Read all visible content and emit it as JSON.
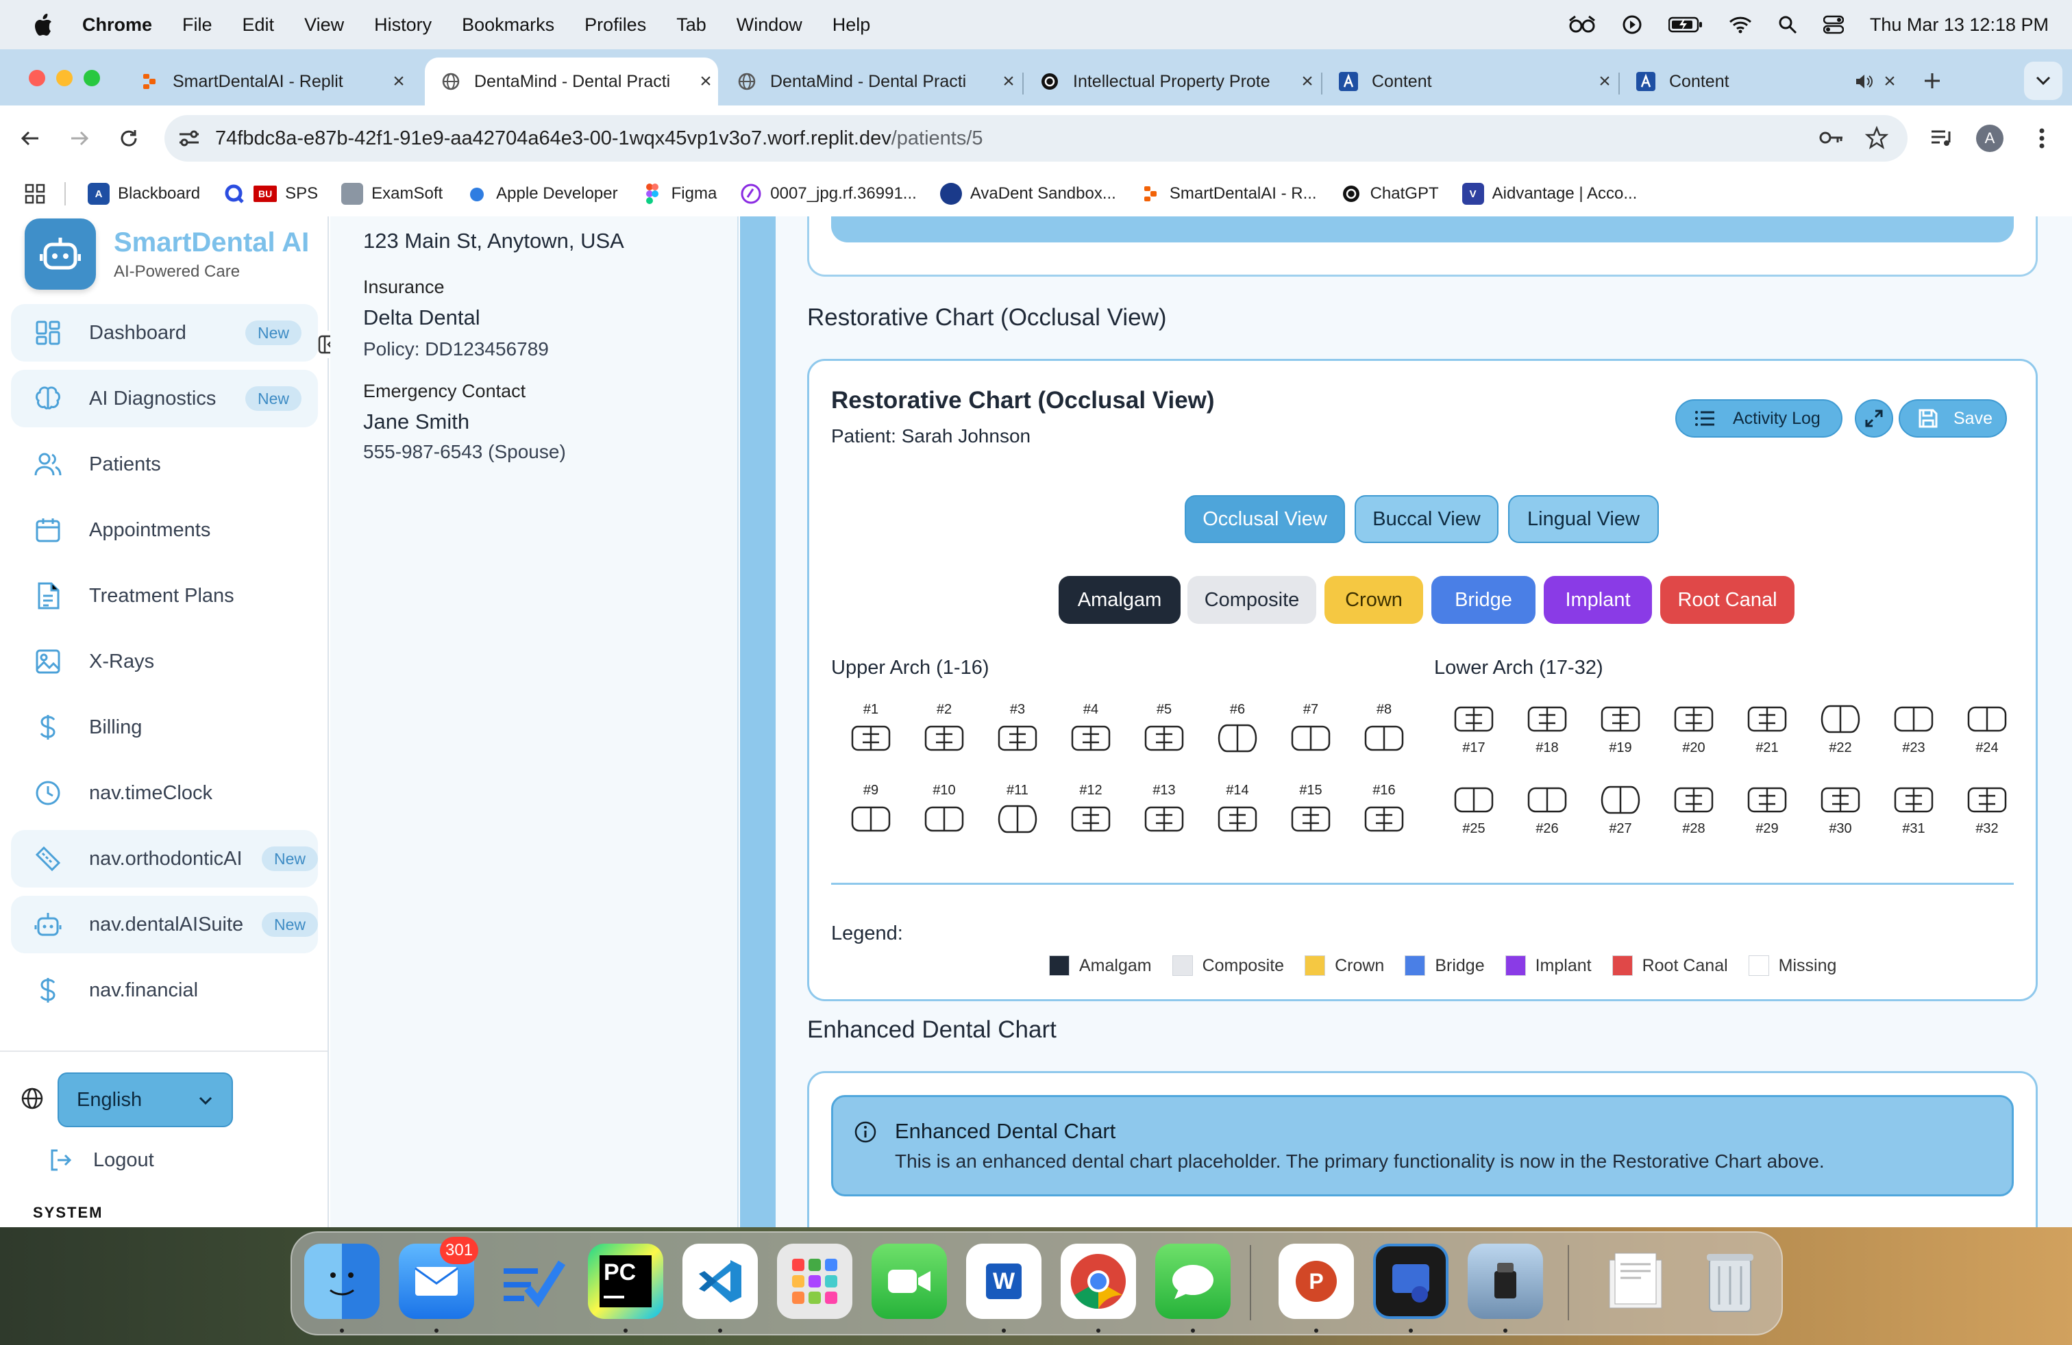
{
  "menubar": {
    "app": "Chrome",
    "items": [
      "File",
      "Edit",
      "View",
      "History",
      "Bookmarks",
      "Profiles",
      "Tab",
      "Window",
      "Help"
    ],
    "clock": "Thu Mar 13  12:18 PM"
  },
  "tabs": [
    {
      "title": "SmartDentalAI - Replit",
      "icon": "replit-icon"
    },
    {
      "title": "DentaMind - Dental Practi",
      "icon": "globe-icon"
    },
    {
      "title": "DentaMind - Dental Practi",
      "icon": "globe-icon"
    },
    {
      "title": "Intellectual Property Prote",
      "icon": "openai-icon"
    },
    {
      "title": "Content",
      "icon": "content-icon"
    },
    {
      "title": "Content",
      "icon": "content-icon"
    }
  ],
  "address": {
    "url_host": "74fbdc8a-e87b-42f1-91e9-aa42704a64e3-00-1wqx45vp1v3o7.worf.replit.dev",
    "url_path": "/patients/5"
  },
  "bookmarks": [
    "Blackboard",
    "SPS",
    "ExamSoft",
    "Apple Developer",
    "Figma",
    "0007_jpg.rf.36991...",
    "AvaDent Sandbox...",
    "SmartDentalAI - R...",
    "ChatGPT",
    "Aidvantage | Acco..."
  ],
  "sidebar": {
    "brand_name": "SmartDental AI",
    "brand_tagline": "AI-Powered Care",
    "items": [
      {
        "label": "Dashboard",
        "badge": "New"
      },
      {
        "label": "AI Diagnostics",
        "badge": "New"
      },
      {
        "label": "Patients"
      },
      {
        "label": "Appointments"
      },
      {
        "label": "Treatment Plans"
      },
      {
        "label": "X-Rays"
      },
      {
        "label": "Billing"
      },
      {
        "label": "nav.timeClock"
      },
      {
        "label": "nav.orthodonticAI",
        "badge": "New"
      },
      {
        "label": "nav.dentalAISuite",
        "badge": "New"
      },
      {
        "label": "nav.financial"
      }
    ],
    "language": "English",
    "logout": "Logout",
    "section": "SYSTEM"
  },
  "patient_info": {
    "address": "123 Main St, Anytown, USA",
    "insurance_label": "Insurance",
    "insurance": "Delta Dental",
    "policy": "Policy: DD123456789",
    "emergency_label": "Emergency Contact",
    "emergency_name": "Jane Smith",
    "emergency_phone": "555-987-6543 (Spouse)"
  },
  "restorative": {
    "section_title": "Restorative Chart (Occlusal View)",
    "card_title": "Restorative Chart (Occlusal View)",
    "patient": "Patient: Sarah Johnson",
    "activity_log": "Activity Log",
    "save": "Save",
    "views": [
      "Occlusal View",
      "Buccal View",
      "Lingual View"
    ],
    "materials": [
      {
        "label": "Amalgam",
        "bg": "#1f2937",
        "fg": "#ffffff"
      },
      {
        "label": "Composite",
        "bg": "#e5e7eb",
        "fg": "#1f2937"
      },
      {
        "label": "Crown",
        "bg": "#f5c842",
        "fg": "#3b2f00"
      },
      {
        "label": "Bridge",
        "bg": "#4a7fe6",
        "fg": "#ffffff"
      },
      {
        "label": "Implant",
        "bg": "#8a3be6",
        "fg": "#ffffff"
      },
      {
        "label": "Root Canal",
        "bg": "#e04848",
        "fg": "#ffffff"
      }
    ],
    "upper_title": "Upper Arch (1-16)",
    "lower_title": "Lower Arch (17-32)",
    "upper_row1": [
      "#1",
      "#2",
      "#3",
      "#4",
      "#5",
      "#6",
      "#7",
      "#8"
    ],
    "upper_row2": [
      "#9",
      "#10",
      "#11",
      "#12",
      "#13",
      "#14",
      "#15",
      "#16"
    ],
    "lower_row1": [
      "#17",
      "#18",
      "#19",
      "#20",
      "#21",
      "#22",
      "#23",
      "#24"
    ],
    "lower_row2": [
      "#25",
      "#26",
      "#27",
      "#28",
      "#29",
      "#30",
      "#31",
      "#32"
    ],
    "legend_title": "Legend:",
    "legend": [
      {
        "label": "Amalgam",
        "color": "#1f2937"
      },
      {
        "label": "Composite",
        "color": "#e5e7eb"
      },
      {
        "label": "Crown",
        "color": "#f5c842"
      },
      {
        "label": "Bridge",
        "color": "#4a7fe6"
      },
      {
        "label": "Implant",
        "color": "#8a3be6"
      },
      {
        "label": "Root Canal",
        "color": "#e04848"
      },
      {
        "label": "Missing",
        "color": "#ffffff"
      }
    ]
  },
  "enhanced": {
    "section_title": "Enhanced Dental Chart",
    "title": "Enhanced Dental Chart",
    "description": "This is an enhanced dental chart placeholder. The primary functionality is now in the Restorative Chart above."
  },
  "dock": {
    "mail_badge": "301",
    "apps": [
      "Finder",
      "Mail",
      "Tasks",
      "PyCharm",
      "Visual Studio Code",
      "Launchpad",
      "FaceTime",
      "Microsoft Word",
      "Google Chrome",
      "Messages",
      "Microsoft PowerPoint",
      "Preview",
      "Image Capture",
      "Document",
      "Trash"
    ]
  }
}
